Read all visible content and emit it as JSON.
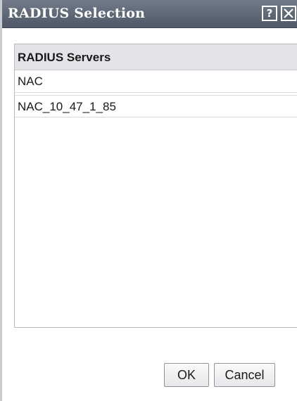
{
  "dialog": {
    "title": "RADIUS Selection",
    "help_label": "?",
    "close_icon": "close-icon"
  },
  "list": {
    "header": "RADIUS Servers",
    "rows": [
      "NAC",
      "NAC_10_47_1_85"
    ]
  },
  "buttons": {
    "ok_label": "OK",
    "cancel_label": "Cancel"
  },
  "colors": {
    "titlebar": "#5d6775",
    "header_bg": "#e2e4e7"
  }
}
